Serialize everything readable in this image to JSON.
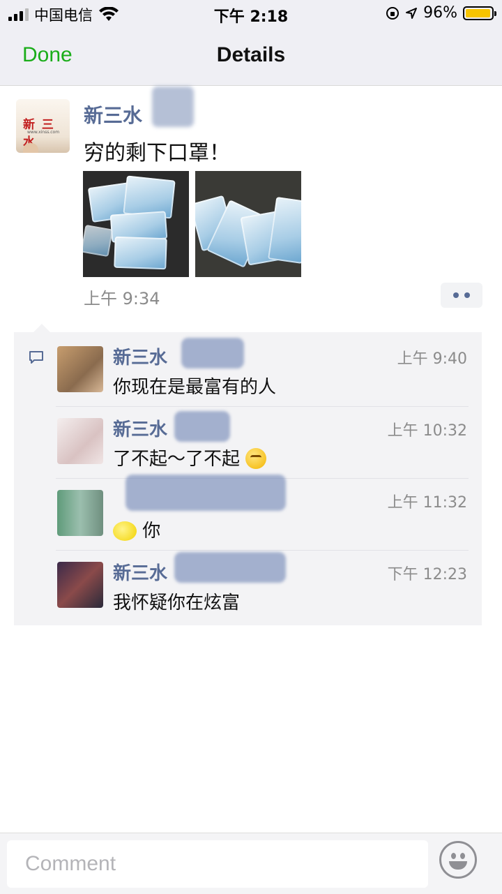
{
  "status_bar": {
    "carrier": "中国电信",
    "time": "下午 2:18",
    "battery_percent": "96%",
    "battery_level": 0.96,
    "battery_color": "#f7c400"
  },
  "nav": {
    "done_label": "Done",
    "title": "Details"
  },
  "post": {
    "author": "新三水",
    "avatar_logo": "新 三 水",
    "text": "穷的剩下口罩！",
    "time": "上午 9:34",
    "images": [
      "mask-photo-1",
      "mask-photo-2"
    ]
  },
  "comments": [
    {
      "name": "新三水",
      "time": "上午 9:40",
      "text": "你现在是最富有的人",
      "emoji": ""
    },
    {
      "name": "新三水",
      "time": "上午 10:32",
      "text": "了不起～了不起",
      "emoji": "thinking-face"
    },
    {
      "name": "",
      "time": "上午 11:32",
      "text": "你",
      "emoji_before": "lemon"
    },
    {
      "name": "新三水",
      "time": "下午 12:23",
      "text": "我怀疑你在炫富",
      "emoji": ""
    }
  ],
  "comment_bar": {
    "placeholder": "Comment"
  },
  "colors": {
    "accent_green": "#1aad19",
    "name_blue": "#576b95"
  }
}
